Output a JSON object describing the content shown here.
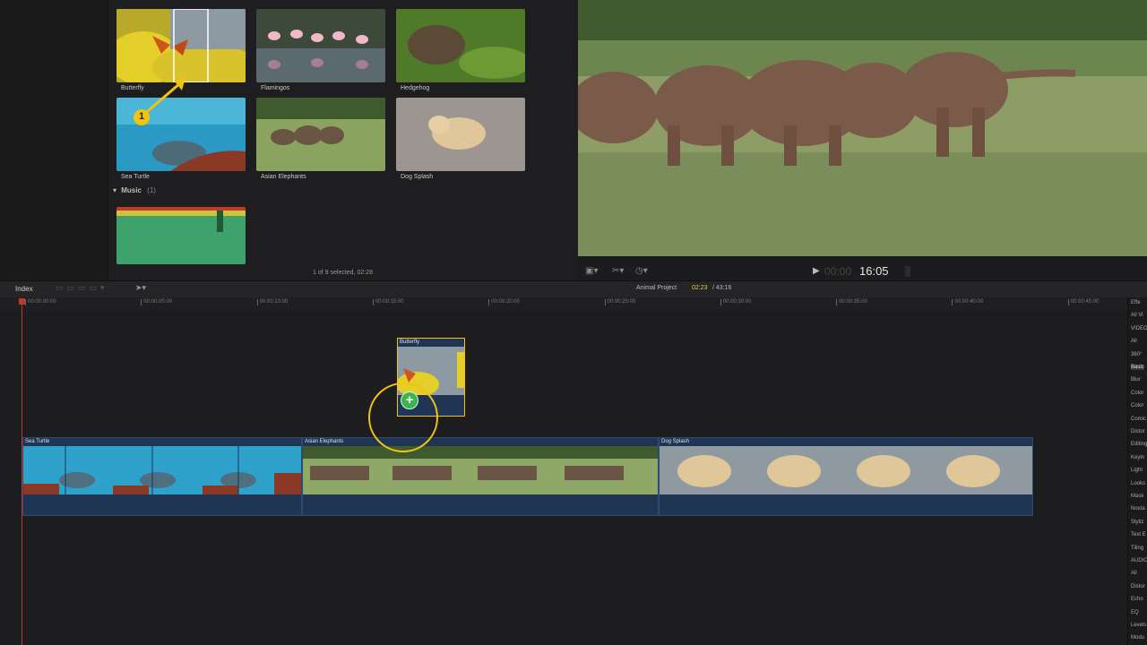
{
  "browser": {
    "clips": [
      {
        "label": "Butterfly"
      },
      {
        "label": "Flamingos"
      },
      {
        "label": "Hedgehog"
      },
      {
        "label": "Sea Turtle"
      },
      {
        "label": "Asian Elephants"
      },
      {
        "label": "Dog Splash"
      }
    ],
    "music_section": {
      "label": "Music",
      "count": "(1)"
    },
    "status": "1 of 9 selected, 02:28",
    "callout_number": "1"
  },
  "viewer": {
    "timecode": "16:05"
  },
  "timeline": {
    "index_label": "Index",
    "project_name": "Animal Project",
    "duration_current": "02:23",
    "duration_total": "/ 43:16",
    "ruler_ticks": [
      "00:00:00:00",
      "00:00:05:00",
      "00:00:10:00",
      "00:00:15:00",
      "00:00:20:00",
      "00:00:25:00",
      "00:00:30:00",
      "00:00:35:00",
      "00:00:40:00",
      "00:00:45:00"
    ],
    "dragged_clip": {
      "label": "Butterfly"
    },
    "clips": [
      {
        "label": "Sea Turtle"
      },
      {
        "label": "Asian Elephants"
      },
      {
        "label": "Dog Splash"
      }
    ]
  },
  "effects": {
    "items": [
      "Effe",
      "All Vi",
      "VIDEO",
      "All",
      "360°",
      "Basic",
      "Blur",
      "Color",
      "Color",
      "Comic",
      "Distor",
      "Editing",
      "Keyin",
      "Light",
      "Looks",
      "Mask",
      "Nosta",
      "Styliz",
      "Text E",
      "Tiling",
      "AUDIO",
      "All",
      "Distor",
      "Echo",
      "EQ",
      "Levels",
      "Modu"
    ]
  },
  "colors": {
    "selection_yellow": "#f1c40f",
    "clip_blue": "#1f3553",
    "timecode_yellow": "#e8c84a",
    "playhead_red": "#c0392b",
    "add_green": "#3fb34f"
  }
}
